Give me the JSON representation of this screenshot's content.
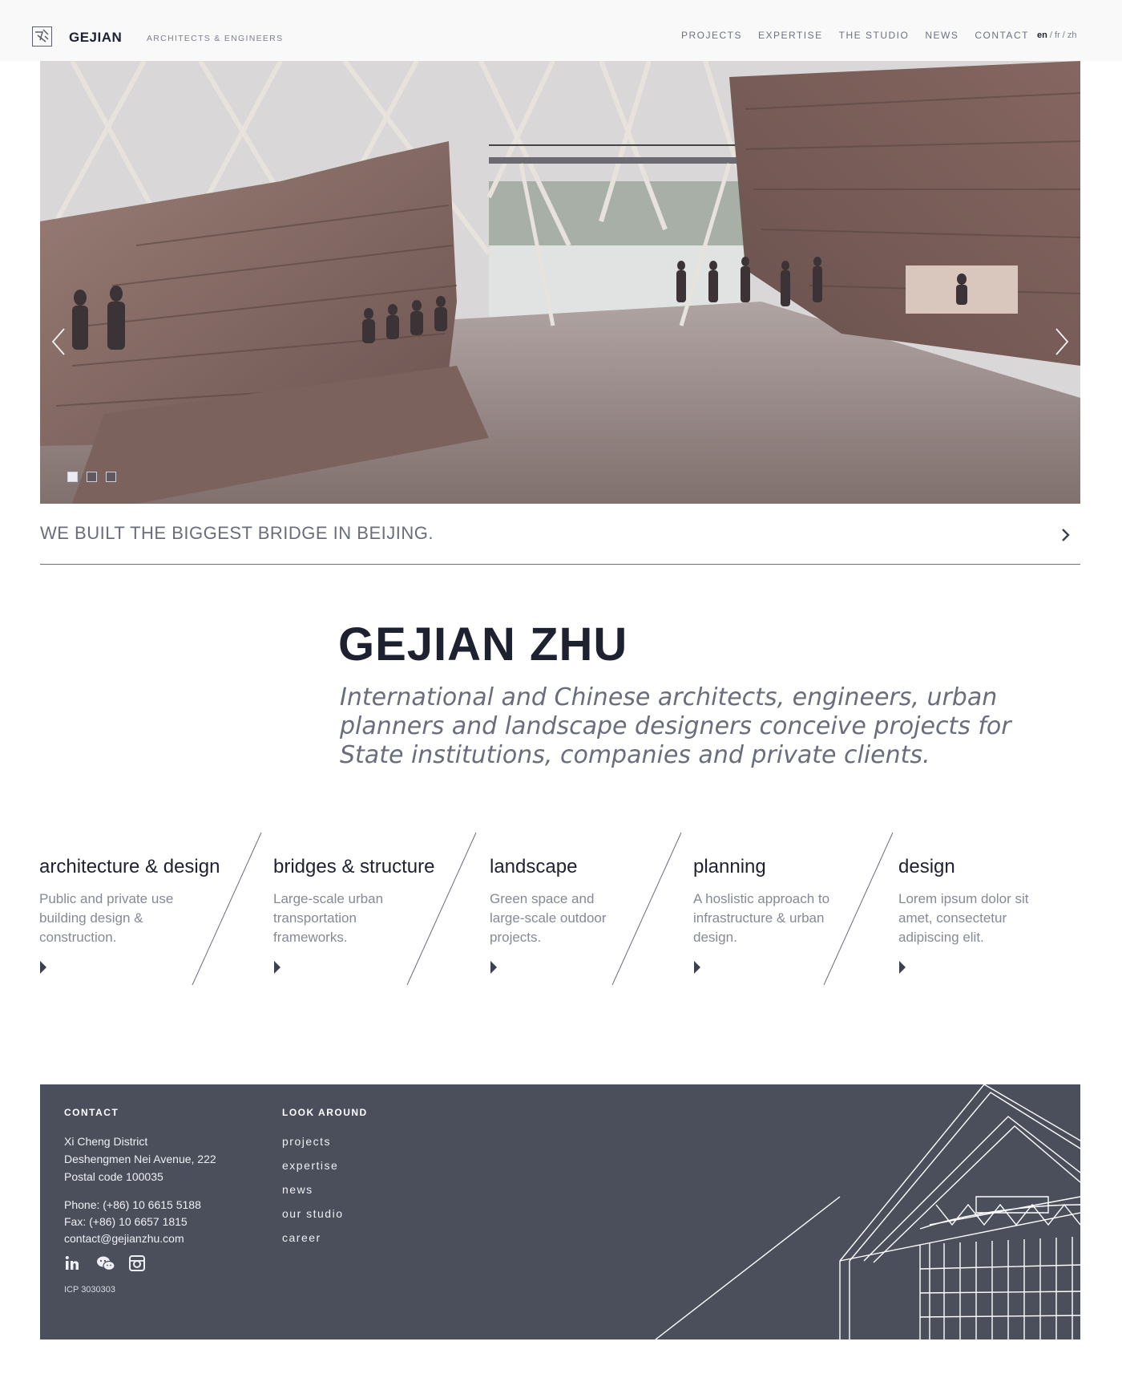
{
  "header": {
    "brand": "GEJIAN",
    "tagline": "ARCHITECTS & ENGINEERS",
    "nav": [
      "PROJECTS",
      "EXPERTISE",
      "THE STUDIO",
      "NEWS",
      "CONTACT"
    ],
    "lang": [
      "en",
      "fr",
      "zh"
    ],
    "lang_active": "en"
  },
  "hero": {
    "slides_count": 3,
    "active_slide": 1
  },
  "promo": {
    "text": "WE BUILT THE BIGGEST BRIDGE IN BEIJING."
  },
  "intro": {
    "title": "GEJIAN ZHU",
    "text": "International and Chinese architects, engineers, urban planners and landscape designers conceive projects for State institutions, companies and private clients."
  },
  "expertise": [
    {
      "title": "architecture & design",
      "desc": "Public and private use building design & construction."
    },
    {
      "title": "bridges & structure",
      "desc": "Large-scale urban transportation frameworks."
    },
    {
      "title": "landscape",
      "desc": "Green space and large-scale outdoor projects."
    },
    {
      "title": "planning",
      "desc": "A hoslistic approach to infrastructure & urban design."
    },
    {
      "title": "design",
      "desc": "Lorem ipsum dolor sit amet, consectetur adipiscing elit."
    }
  ],
  "footer": {
    "contact_heading": "CONTACT",
    "address": [
      "Xi Cheng District",
      "Deshengmen Nei Avenue, 222",
      "Postal code 100035"
    ],
    "phone": "Phone: (+86) 10 6615 5188",
    "fax": "Fax: (+86) 10 6657 1815",
    "email": "contact@gejianzhu.com",
    "social_icons": [
      "linkedin-icon",
      "wechat-icon",
      "instagram-icon"
    ],
    "icp": "ICP 3030303",
    "look_heading": "LOOK AROUND",
    "links": [
      "projects",
      "expertise",
      "news",
      "our studio",
      "career"
    ]
  },
  "colors": {
    "dark": "#1e2130",
    "footer_bg": "#4b4f5c",
    "muted": "#6a6d7b"
  }
}
